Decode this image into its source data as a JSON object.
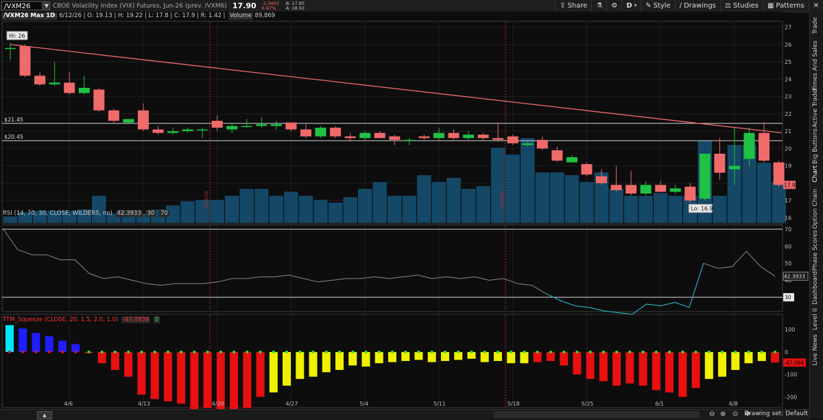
{
  "toolbar": {
    "symbol": "/VXM26",
    "description": "CBOE Volatility Index (VIX) Futures, Jun-26 (prev. /VXM6)",
    "last": "17.90",
    "change": "-1.3403",
    "change_pct": "6.97%",
    "bid": "B: 17.85",
    "ask": "A: 18.50",
    "buttons": [
      "Share",
      "D",
      "Style",
      "Drawings",
      "Studies",
      "Patterns"
    ]
  },
  "info": {
    "label": "/VXM26 Max 1D",
    "date": "D: 6/12/26",
    "open": "O: 19.13",
    "high": "H: 19.22",
    "low": "L: 17.8",
    "close": "C: 17.9",
    "range": "R: 1.42",
    "volume_label": "Volume",
    "volume": "89,869"
  },
  "annotations": {
    "hi": "Hi: 26",
    "lo": "Lo: 16.9",
    "level_upper": "$21.45",
    "level_lower": "$20.45",
    "price_tag": "17.9",
    "vline_1": "4/20/26",
    "vline_2": "5/18/26"
  },
  "rsi": {
    "study": "RSI (14, 70, 30, CLOSE, WILDERS, no)",
    "value": "42.3933",
    "overbought": "70",
    "oversold": "30",
    "axis_ticks": [
      "70",
      "60",
      "50",
      "40",
      "30"
    ]
  },
  "ttm": {
    "study": "TTM_Squeeze (CLOSE, 20, 1.5, 2.0, 1.0)",
    "value": "-47.0939",
    "zero": "0",
    "price_tag": "-47.094",
    "axis_ticks": [
      "100",
      "0",
      "-100",
      "-200"
    ]
  },
  "price_axis_ticks": [
    "27",
    "26",
    "25",
    "24",
    "23",
    "22",
    "21",
    "20",
    "19",
    "18",
    "17",
    "16"
  ],
  "x_ticks": [
    "4/6",
    "4/13",
    "4/20",
    "4/27",
    "5/4",
    "5/11",
    "5/18",
    "5/25",
    "6/1",
    "6/8"
  ],
  "sidebar": [
    "Trade",
    "Times And Sales",
    "Active Trader",
    "Big Buttons",
    "Chart",
    "Option Chain",
    "Phase Scores",
    "Dashboard",
    "Level II",
    "Live News"
  ],
  "bottom": {
    "drawing_set": "Drawing set: Default"
  },
  "colors": {
    "up": "#1fc244",
    "down": "#f06a6a",
    "volume": "#144866",
    "trend": "#f36b6b",
    "rsi": "#8b8b8b",
    "rsi_low": "#1ab5cc",
    "ttm_red": "#e81010",
    "ttm_yellow": "#f0f000",
    "ttm_blue": "#1e1eff",
    "ttm_cyan": "#00e5ff"
  },
  "chart_data": {
    "type": "candlestick",
    "candles": [
      {
        "o": 25.8,
        "h": 26.1,
        "l": 25.1,
        "c": 25.8
      },
      {
        "o": 25.9,
        "h": 26.0,
        "l": 24.1,
        "c": 24.2
      },
      {
        "o": 24.2,
        "h": 24.4,
        "l": 23.6,
        "c": 23.7
      },
      {
        "o": 23.7,
        "h": 25.0,
        "l": 23.6,
        "c": 23.8
      },
      {
        "o": 23.8,
        "h": 24.4,
        "l": 23.1,
        "c": 23.2
      },
      {
        "o": 23.2,
        "h": 24.2,
        "l": 23.1,
        "c": 23.5
      },
      {
        "o": 23.4,
        "h": 23.5,
        "l": 22.1,
        "c": 22.2
      },
      {
        "o": 22.2,
        "h": 22.3,
        "l": 21.5,
        "c": 21.6
      },
      {
        "o": 21.5,
        "h": 21.7,
        "l": 21.4,
        "c": 21.7
      },
      {
        "o": 22.2,
        "h": 22.6,
        "l": 21.0,
        "c": 21.1
      },
      {
        "o": 21.1,
        "h": 21.3,
        "l": 20.8,
        "c": 20.9
      },
      {
        "o": 20.9,
        "h": 21.2,
        "l": 20.8,
        "c": 21.0
      },
      {
        "o": 21.0,
        "h": 21.2,
        "l": 20.9,
        "c": 21.1
      },
      {
        "o": 21.1,
        "h": 21.2,
        "l": 20.6,
        "c": 21.1
      },
      {
        "o": 21.6,
        "h": 21.9,
        "l": 21.0,
        "c": 21.2
      },
      {
        "o": 21.1,
        "h": 21.5,
        "l": 20.9,
        "c": 21.3
      },
      {
        "o": 21.3,
        "h": 21.7,
        "l": 21.2,
        "c": 21.3
      },
      {
        "o": 21.3,
        "h": 21.8,
        "l": 21.2,
        "c": 21.4
      },
      {
        "o": 21.3,
        "h": 21.6,
        "l": 21.1,
        "c": 21.4
      },
      {
        "o": 21.5,
        "h": 21.5,
        "l": 21.0,
        "c": 21.1
      },
      {
        "o": 21.1,
        "h": 21.4,
        "l": 20.6,
        "c": 20.7
      },
      {
        "o": 20.7,
        "h": 21.3,
        "l": 20.6,
        "c": 21.2
      },
      {
        "o": 21.2,
        "h": 21.3,
        "l": 20.6,
        "c": 20.7
      },
      {
        "o": 20.7,
        "h": 20.9,
        "l": 20.4,
        "c": 20.6
      },
      {
        "o": 20.6,
        "h": 21.0,
        "l": 20.5,
        "c": 20.9
      },
      {
        "o": 20.9,
        "h": 21.0,
        "l": 20.6,
        "c": 20.6
      },
      {
        "o": 20.7,
        "h": 20.8,
        "l": 20.2,
        "c": 20.5
      },
      {
        "o": 20.5,
        "h": 20.6,
        "l": 20.2,
        "c": 20.5
      },
      {
        "o": 20.7,
        "h": 20.8,
        "l": 20.5,
        "c": 20.6
      },
      {
        "o": 20.6,
        "h": 21.2,
        "l": 20.5,
        "c": 20.9
      },
      {
        "o": 20.9,
        "h": 21.1,
        "l": 20.5,
        "c": 20.6
      },
      {
        "o": 20.6,
        "h": 21.0,
        "l": 20.5,
        "c": 20.8
      },
      {
        "o": 20.8,
        "h": 20.9,
        "l": 20.5,
        "c": 20.6
      },
      {
        "o": 20.6,
        "h": 21.5,
        "l": 20.4,
        "c": 20.5
      },
      {
        "o": 20.7,
        "h": 20.8,
        "l": 20.2,
        "c": 20.3
      },
      {
        "o": 20.2,
        "h": 20.4,
        "l": 20.1,
        "c": 20.3
      },
      {
        "o": 20.5,
        "h": 20.7,
        "l": 19.9,
        "c": 20.0
      },
      {
        "o": 19.9,
        "h": 20.1,
        "l": 19.2,
        "c": 19.3
      },
      {
        "o": 19.2,
        "h": 19.6,
        "l": 19.2,
        "c": 19.5
      },
      {
        "o": 19.1,
        "h": 19.2,
        "l": 18.4,
        "c": 18.5
      },
      {
        "o": 18.4,
        "h": 18.8,
        "l": 17.9,
        "c": 18.0
      },
      {
        "o": 17.9,
        "h": 19.0,
        "l": 17.5,
        "c": 17.6
      },
      {
        "o": 17.9,
        "h": 18.7,
        "l": 17.3,
        "c": 17.4
      },
      {
        "o": 17.4,
        "h": 18.1,
        "l": 17.3,
        "c": 17.9
      },
      {
        "o": 17.9,
        "h": 18.1,
        "l": 17.5,
        "c": 17.5
      },
      {
        "o": 17.5,
        "h": 17.9,
        "l": 17.4,
        "c": 17.7
      },
      {
        "o": 17.8,
        "h": 18.0,
        "l": 16.9,
        "c": 17.0
      },
      {
        "o": 17.1,
        "h": 19.7,
        "l": 17.0,
        "c": 19.7
      },
      {
        "o": 19.7,
        "h": 20.6,
        "l": 18.2,
        "c": 18.6
      },
      {
        "o": 18.8,
        "h": 21.2,
        "l": 17.9,
        "c": 19.0
      },
      {
        "o": 19.4,
        "h": 21.2,
        "l": 19.0,
        "c": 20.9
      },
      {
        "o": 20.9,
        "h": 21.5,
        "l": 19.2,
        "c": 19.3
      },
      {
        "o": 19.2,
        "h": 19.3,
        "l": 17.8,
        "c": 17.9
      }
    ],
    "volume_rel": [
      0.05,
      0.08,
      0.09,
      0.09,
      0.09,
      0.1,
      0.2,
      0.07,
      0.07,
      0.07,
      0.1,
      0.13,
      0.16,
      0.17,
      0.17,
      0.2,
      0.25,
      0.25,
      0.2,
      0.23,
      0.2,
      0.17,
      0.15,
      0.19,
      0.25,
      0.3,
      0.2,
      0.2,
      0.35,
      0.3,
      0.33,
      0.25,
      0.27,
      0.55,
      0.5,
      0.62,
      0.37,
      0.37,
      0.35,
      0.3,
      0.37,
      0.25,
      0.2,
      0.2,
      0.22,
      0.2,
      0.2,
      0.6,
      0.2,
      0.57,
      0.57,
      0.44,
      0.3
    ],
    "rsi_values": [
      70,
      58,
      55,
      55,
      52,
      52,
      44,
      41,
      42,
      40,
      38,
      37,
      38,
      38,
      38,
      39,
      41,
      41,
      42,
      42,
      43,
      41,
      39,
      40,
      41,
      41,
      42,
      41,
      42,
      43,
      41,
      42,
      41,
      42,
      40,
      41,
      38,
      37,
      32,
      28,
      25,
      24,
      22,
      21,
      20,
      26,
      25,
      27,
      24,
      50,
      47,
      48,
      57,
      48,
      42.4
    ],
    "ttm_values": [
      120,
      105,
      85,
      70,
      50,
      35,
      -5,
      -50,
      -80,
      -110,
      -190,
      -210,
      -220,
      -230,
      -260,
      -250,
      -270,
      -270,
      -250,
      -200,
      -180,
      -150,
      -120,
      -110,
      -90,
      -80,
      -60,
      -65,
      -50,
      -45,
      -40,
      -35,
      -45,
      -40,
      -35,
      -30,
      -45,
      -40,
      -50,
      -50,
      -45,
      -40,
      -60,
      -100,
      -120,
      -130,
      -150,
      -140,
      -150,
      -170,
      -180,
      -200,
      -160,
      -120,
      -110,
      -80,
      -50,
      -40,
      -47
    ],
    "ttm_colors": [
      "c",
      "b",
      "b",
      "b",
      "b",
      "b",
      "r",
      "r",
      "r",
      "r",
      "r",
      "r",
      "r",
      "r",
      "r",
      "r",
      "r",
      "r",
      "r",
      "r",
      "y",
      "y",
      "y",
      "y",
      "y",
      "y",
      "y",
      "y",
      "y",
      "y",
      "y",
      "y",
      "y",
      "y",
      "y",
      "y",
      "y",
      "y",
      "y",
      "y",
      "r",
      "r",
      "r",
      "r",
      "r",
      "r",
      "r",
      "r",
      "r",
      "r",
      "r",
      "r",
      "r",
      "y",
      "y",
      "y",
      "y",
      "y",
      "r"
    ],
    "trendline": {
      "from": {
        "i": 0,
        "v": 26
      },
      "to": {
        "i": 52.2,
        "v": 20.9
      }
    },
    "levels": [
      21.45,
      20.45
    ],
    "y_range": [
      15.7,
      27.3
    ]
  }
}
